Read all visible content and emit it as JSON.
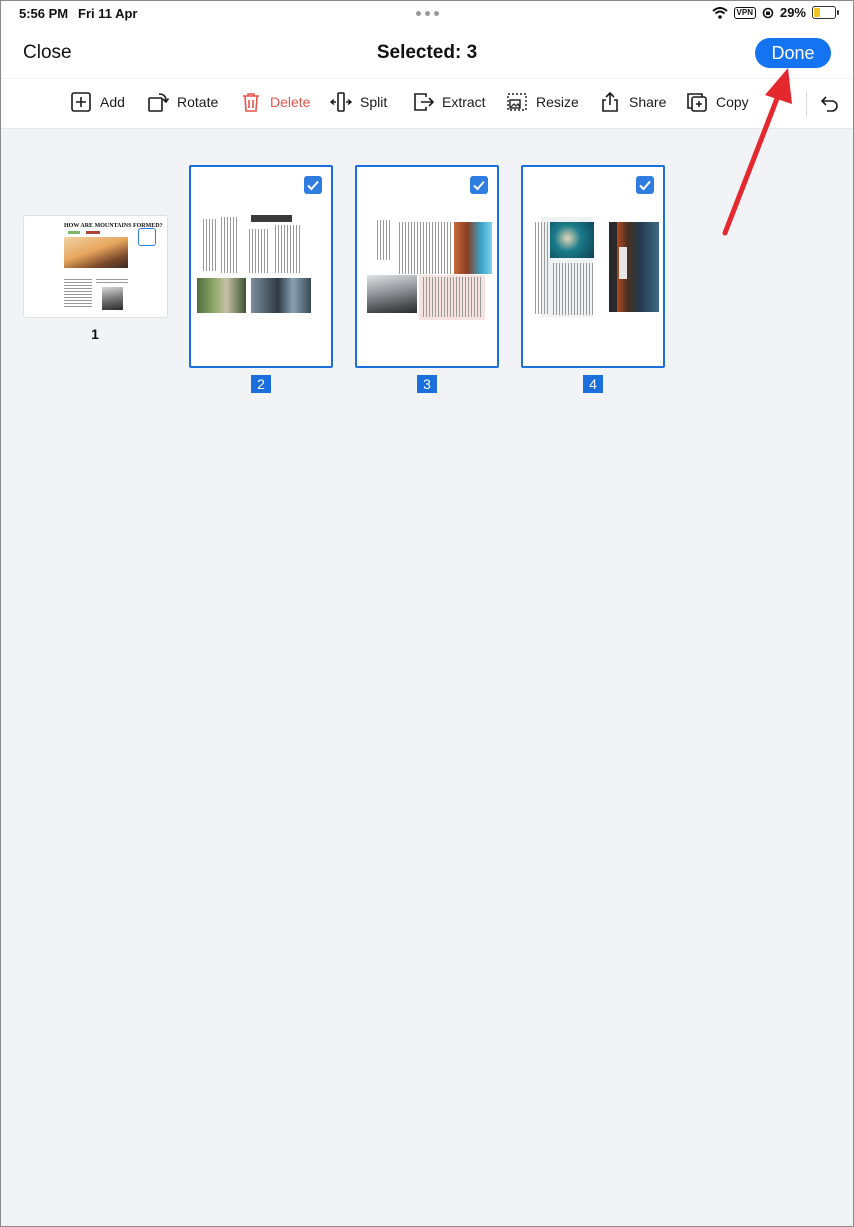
{
  "status_bar": {
    "time": "5:56 PM",
    "date": "Fri 11 Apr",
    "vpn": "VPN",
    "battery": "29%",
    "battery_level": 0.29
  },
  "nav": {
    "close_label": "Close",
    "title": "Selected: 3",
    "done_label": "Done"
  },
  "toolbar": {
    "add": "Add",
    "rotate": "Rotate",
    "delete": "Delete",
    "split": "Split",
    "extract": "Extract",
    "resize": "Resize",
    "share": "Share",
    "copy": "Copy"
  },
  "pages": [
    {
      "number": "1",
      "selected": false,
      "heading": "HOW ARE MOUNTAINS FORMED?"
    },
    {
      "number": "2",
      "selected": true
    },
    {
      "number": "3",
      "selected": true
    },
    {
      "number": "4",
      "selected": true
    }
  ],
  "colors": {
    "accent": "#1473f0",
    "delete": "#e4554a",
    "annotation_arrow": "#e3282e"
  }
}
